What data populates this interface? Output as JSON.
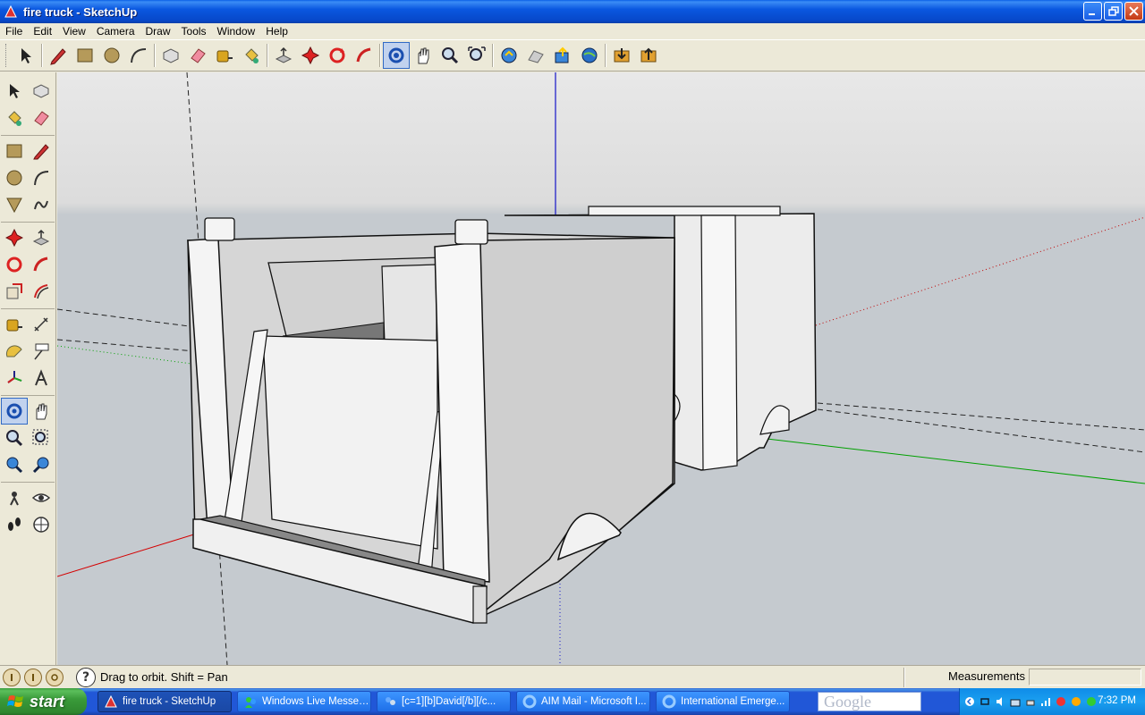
{
  "window": {
    "title": "fire truck - SketchUp"
  },
  "menu": {
    "items": [
      "File",
      "Edit",
      "View",
      "Camera",
      "Draw",
      "Tools",
      "Window",
      "Help"
    ]
  },
  "toolbar": {
    "tools": [
      "select-icon",
      "pencil-icon",
      "rectangle-icon",
      "circle-icon",
      "arc-icon",
      "make-component-icon",
      "eraser-icon",
      "tape-measure-icon",
      "paint-bucket-icon",
      "push-pull-icon",
      "move-icon",
      "rotate-icon",
      "follow-me-icon",
      "orbit-icon",
      "pan-icon",
      "zoom-icon",
      "zoom-extents-icon",
      "get-current-view-icon",
      "toggle-terrain-icon",
      "place-model-icon",
      "get-models-icon",
      "share-model-icon"
    ]
  },
  "status": {
    "hint": "Drag to orbit.  Shift = Pan",
    "measurements_label": "Measurements",
    "measurements_value": ""
  },
  "taskbar": {
    "start_label": "start",
    "tasks": [
      {
        "label": "fire truck - SketchUp",
        "active": true
      },
      {
        "label": "Windows Live Messen...",
        "active": false
      },
      {
        "label": "[c=1][b]David[/b][/c...",
        "active": false
      },
      {
        "label": "AIM Mail - Microsoft I...",
        "active": false
      },
      {
        "label": "International Emerge...",
        "active": false
      }
    ],
    "search_placeholder": "Google",
    "clock": "7:32 PM"
  },
  "colors": {
    "title_blue": "#0a57e0",
    "axis_red": "#d40000",
    "axis_green": "#00a000",
    "axis_blue": "#0000d0",
    "sky": "#e4e4e4",
    "ground": "#c5cacf"
  }
}
